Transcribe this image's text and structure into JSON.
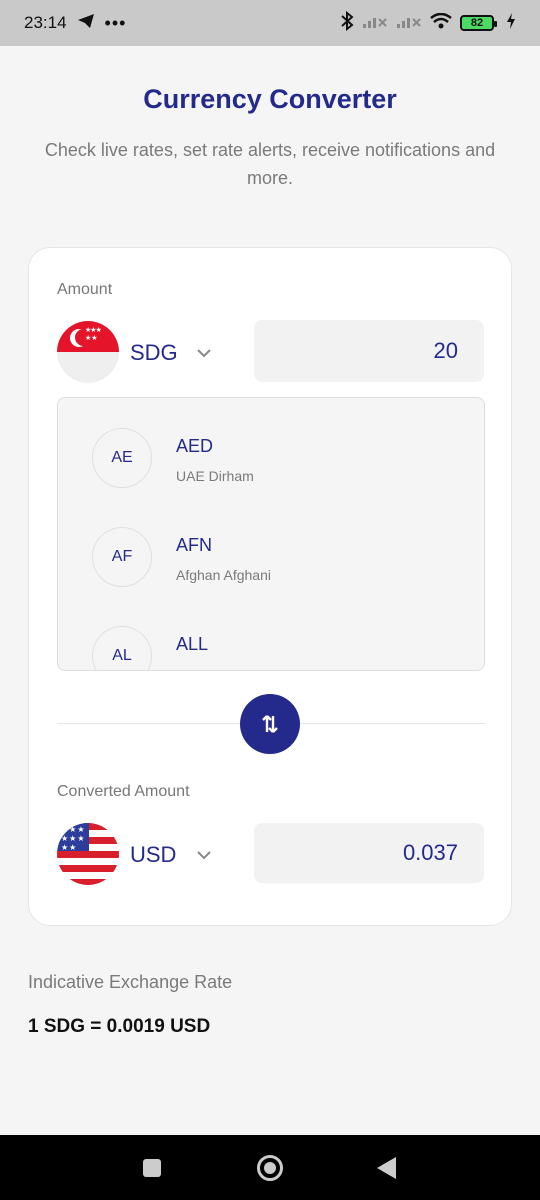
{
  "status_bar": {
    "time": "23:14",
    "icons": [
      "telegram-icon",
      "more-dots-icon",
      "bluetooth-icon",
      "signal-1-icon",
      "signal-2-icon",
      "wifi-icon",
      "battery-icon",
      "charging-icon"
    ],
    "battery": "82"
  },
  "header": {
    "title": "Currency Converter",
    "subtitle": "Check live rates, set rate alerts, receive notifications and more."
  },
  "from": {
    "label": "Amount",
    "code": "SDG",
    "amount": "20"
  },
  "dropdown": {
    "items": [
      {
        "initials": "AE",
        "code": "AED",
        "name": "UAE Dirham"
      },
      {
        "initials": "AF",
        "code": "AFN",
        "name": "Afghan Afghani"
      },
      {
        "initials": "AL",
        "code": "ALL",
        "name": ""
      }
    ]
  },
  "to": {
    "label": "Converted Amount",
    "code": "USD",
    "amount": "0.037"
  },
  "rate": {
    "label": "Indicative Exchange Rate",
    "value": "1 SDG = 0.0019 USD"
  },
  "colors": {
    "primary": "#232a8c",
    "background": "#f5f5f5"
  }
}
